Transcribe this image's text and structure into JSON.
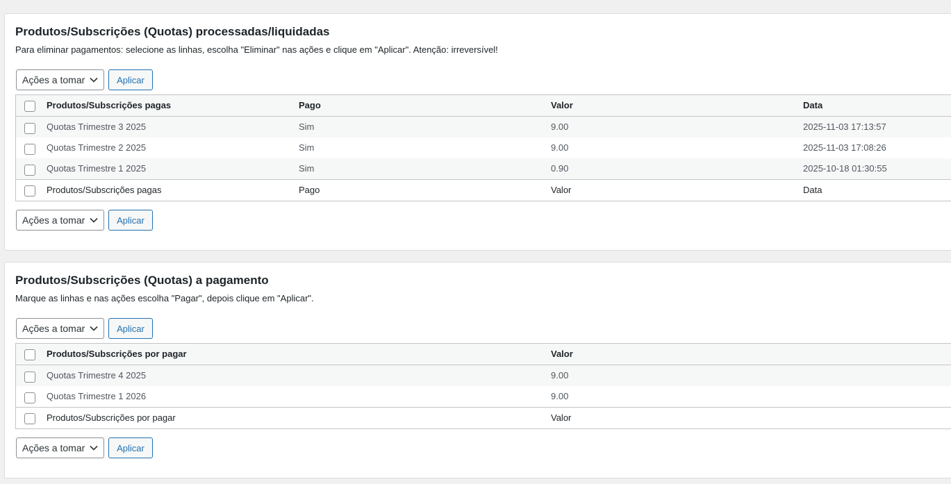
{
  "processed": {
    "title": "Produtos/Subscrições (Quotas) processadas/liquidadas",
    "description": "Para eliminar pagamentos: selecione as linhas, escolha \"Eliminar\" nas ações e clique em \"Aplicar\". Atenção: irreversível!",
    "actions_label": "Ações a tomar",
    "apply_label": "Aplicar",
    "columns": [
      "Produtos/Subscrições pagas",
      "Pago",
      "Valor",
      "Data"
    ],
    "rows": [
      {
        "product": "Quotas Trimestre 3 2025",
        "paid": "Sim",
        "value": "9.00",
        "date": "2025-11-03 17:13:57"
      },
      {
        "product": "Quotas Trimestre 2 2025",
        "paid": "Sim",
        "value": "9.00",
        "date": "2025-11-03 17:08:26"
      },
      {
        "product": "Quotas Trimestre 1 2025",
        "paid": "Sim",
        "value": "0.90",
        "date": "2025-10-18 01:30:55"
      }
    ]
  },
  "pending": {
    "title": "Produtos/Subscrições (Quotas) a pagamento",
    "description": "Marque as linhas e nas ações escolha \"Pagar\", depois clique em \"Aplicar\".",
    "actions_label": "Ações a tomar",
    "apply_label": "Aplicar",
    "columns": [
      "Produtos/Subscrições por pagar",
      "Valor"
    ],
    "rows": [
      {
        "product": "Quotas Trimestre 4 2025",
        "value": "9.00"
      },
      {
        "product": "Quotas Trimestre 1 2026",
        "value": "9.00"
      }
    ]
  },
  "icons": {
    "dropdown": "chevron-down-icon",
    "checkbox": "checkbox-unchecked"
  },
  "colors": {
    "accent": "#2271b1",
    "background": "#f0f0f1",
    "border": "#c3c4c7"
  }
}
